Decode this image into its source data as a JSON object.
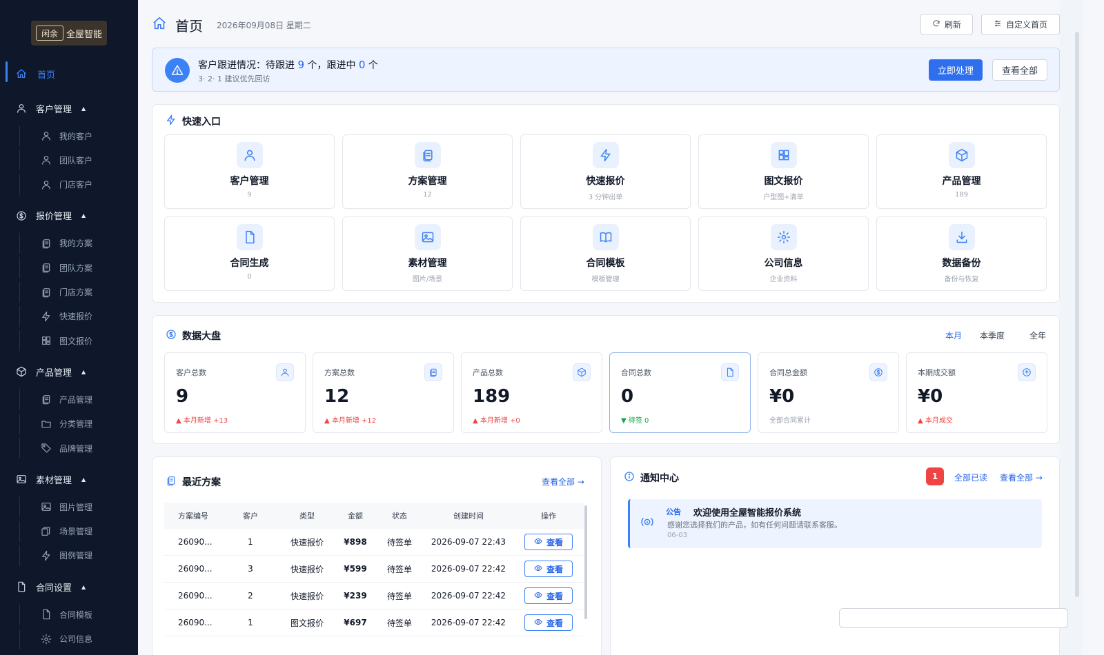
{
  "brand": {
    "logo_seal": "闲余",
    "logo_text": "全屋智能"
  },
  "sidebar": {
    "home": "首页",
    "groups": [
      {
        "label": "客户管理",
        "items": [
          "我的客户",
          "团队客户",
          "门店客户"
        ]
      },
      {
        "label": "报价管理",
        "items": [
          "我的方案",
          "团队方案",
          "门店方案",
          "快速报价",
          "图文报价"
        ]
      },
      {
        "label": "产品管理",
        "items": [
          "产品管理",
          "分类管理",
          "品牌管理"
        ]
      },
      {
        "label": "素材管理",
        "items": [
          "图片管理",
          "场景管理",
          "图例管理"
        ]
      },
      {
        "label": "合同设置",
        "items": [
          "合同模板",
          "公司信息"
        ]
      }
    ],
    "caret": "▲"
  },
  "header": {
    "title": "首页",
    "date": "2026年09月08日 星期二",
    "refresh": "刷新",
    "customize": "自定义首页"
  },
  "alert": {
    "prefix": "客户跟进情况：待跟进",
    "pending": "9",
    "mid": "个，跟进中",
    "in_progress": "0",
    "suffix": "个",
    "hint": "3· 2· 1  建议优先回访",
    "primary": "立即处理",
    "secondary": "查看全部"
  },
  "quick": {
    "title": "快速入口",
    "tiles": [
      {
        "label": "客户管理",
        "sub": "9",
        "icon": "user-icon"
      },
      {
        "label": "方案管理",
        "sub": "12",
        "icon": "clipboard-icon"
      },
      {
        "label": "快速报价",
        "sub": "3 分钟出单",
        "icon": "lightning-icon"
      },
      {
        "label": "图文报价",
        "sub": "户型图+清单",
        "icon": "floorplan-icon"
      },
      {
        "label": "产品管理",
        "sub": "189",
        "icon": "box-icon"
      },
      {
        "label": "合同生成",
        "sub": "0",
        "icon": "document-icon"
      },
      {
        "label": "素材管理",
        "sub": "图片/场景",
        "icon": "image-icon"
      },
      {
        "label": "合同模板",
        "sub": "模板管理",
        "icon": "book-icon"
      },
      {
        "label": "公司信息",
        "sub": "企业资料",
        "icon": "gear-icon"
      },
      {
        "label": "数据备份",
        "sub": "备份与恢复",
        "icon": "download-icon"
      }
    ]
  },
  "dashboard": {
    "title": "数据大盘",
    "periods": [
      "本月",
      "本季度",
      "全年"
    ],
    "active_period": "本月",
    "stats": [
      {
        "label": "客户总数",
        "value": "9",
        "sub": "▲ 本月新增 +13",
        "trend": "up",
        "icon": "user-icon"
      },
      {
        "label": "方案总数",
        "value": "12",
        "sub": "▲ 本月新增 +12",
        "trend": "up",
        "icon": "clipboard-icon"
      },
      {
        "label": "产品总数",
        "value": "189",
        "sub": "▲ 本月新增 +0",
        "trend": "up",
        "icon": "box-icon"
      },
      {
        "label": "合同总数",
        "value": "0",
        "sub": "▼ 待签 0",
        "trend": "down",
        "icon": "document-icon"
      },
      {
        "label": "合同总金额",
        "value": "¥0",
        "sub": "全部合同累计",
        "trend": "plain",
        "icon": "dollar-icon"
      },
      {
        "label": "本期成交额",
        "value": "¥0",
        "sub": "▲ 本月成交",
        "trend": "up",
        "icon": "arrow-up-circle-icon"
      }
    ]
  },
  "recent": {
    "title": "最近方案",
    "view_all": "查看全部 →",
    "columns": [
      "方案编号",
      "客户",
      "类型",
      "金额",
      "状态",
      "创建时间",
      "操作"
    ],
    "view_label": "查看",
    "rows": [
      {
        "id": "26090...",
        "customer": "1",
        "type": "快速报价",
        "amount": "¥898",
        "status": "待签单",
        "created": "2026-09-07 22:43"
      },
      {
        "id": "26090...",
        "customer": "3",
        "type": "快速报价",
        "amount": "¥599",
        "status": "待签单",
        "created": "2026-09-07 22:42"
      },
      {
        "id": "26090...",
        "customer": "2",
        "type": "快速报价",
        "amount": "¥239",
        "status": "待签单",
        "created": "2026-09-07 22:42"
      },
      {
        "id": "26090...",
        "customer": "1",
        "type": "图文报价",
        "amount": "¥697",
        "status": "待签单",
        "created": "2026-09-07 22:42"
      }
    ]
  },
  "notices": {
    "title": "通知中心",
    "unread": "1",
    "mark_all": "全部已读",
    "view_all": "查看全部 →",
    "items": [
      {
        "tag": "公告",
        "title": "欢迎使用全屋智能报价系统",
        "body": "感谢您选择我们的产品，如有任何问题请联系客服。",
        "date": "06-03"
      }
    ]
  },
  "colors": {
    "sidebar_bg": "#0f172a",
    "accent": "#2f6fed",
    "danger": "#ef4444",
    "success": "#16a34a"
  }
}
